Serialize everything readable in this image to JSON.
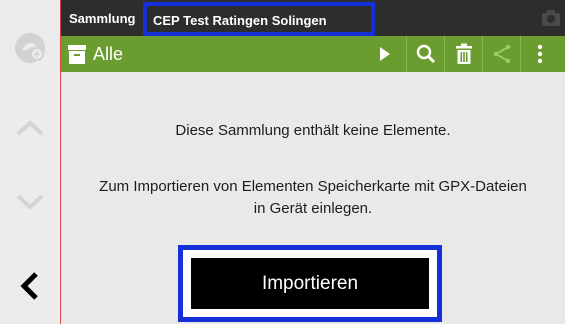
{
  "header": {
    "label": "Sammlung",
    "collection_name": "CEP Test Ratingen Solingen"
  },
  "toolbar": {
    "filter_label": "Alle",
    "icons": [
      "archive-icon",
      "play-icon",
      "search-icon",
      "trash-icon",
      "share-icon",
      "more-icon"
    ]
  },
  "sidebar": {
    "icons": [
      "collection-avatar-icon",
      "chevron-up-icon",
      "chevron-down-icon",
      "back-icon"
    ]
  },
  "content": {
    "empty_message": "Diese Sammlung enthält keine Elemente.",
    "import_line1": "Zum Importieren von Elementen Speicherkarte mit GPX-Dateien",
    "import_line2": "in Gerät einlegen.",
    "import_button": "Importieren"
  },
  "colors": {
    "header_bg": "#2d2d2d",
    "toolbar_bg": "#6b9c2f",
    "highlight": "#1530d8",
    "accent_line": "#d64545"
  }
}
